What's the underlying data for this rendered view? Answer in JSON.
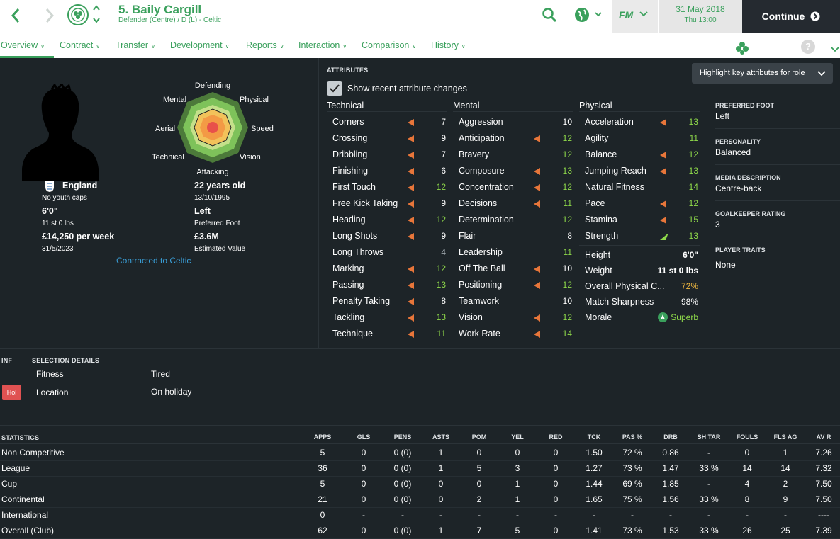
{
  "header": {
    "title": "5. Baily Cargill",
    "subtitle": "Defender (Centre) / D (L) - Celtic",
    "fm_label": "FM",
    "date": "31 May 2018",
    "time": "Thu 13:00",
    "continue_label": "Continue"
  },
  "tabs": [
    {
      "label": "Overview"
    },
    {
      "label": "Contract"
    },
    {
      "label": "Transfer"
    },
    {
      "label": "Development"
    },
    {
      "label": "Reports"
    },
    {
      "label": "Interaction"
    },
    {
      "label": "Comparison"
    },
    {
      "label": "History"
    }
  ],
  "profile": {
    "nation": "England",
    "caps": "No youth caps",
    "age": "22 years old",
    "dob": "13/10/1995",
    "height": "6'0\"",
    "weight": "11 st 0 lbs",
    "foot": "Left",
    "foot_label": "Preferred Foot",
    "wage": "£14,250 per week",
    "contract_end": "31/5/2023",
    "value": "£3.6M",
    "value_label": "Estimated Value",
    "contracted_to": "Contracted to Celtic"
  },
  "radar": {
    "labels": [
      "Defending",
      "Physical",
      "Speed",
      "Vision",
      "Attacking",
      "Technical",
      "Aerial",
      "Mental"
    ]
  },
  "attributes": {
    "header": "ATTRIBUTES",
    "show_changes_label": "Show recent attribute changes",
    "highlight_label": "Highlight key attributes for role",
    "technical_title": "Technical",
    "mental_title": "Mental",
    "physical_title": "Physical",
    "technical": [
      {
        "name": "Corners",
        "value": "7",
        "arrow": true
      },
      {
        "name": "Crossing",
        "value": "9",
        "arrow": true
      },
      {
        "name": "Dribbling",
        "value": "7",
        "arrow": true
      },
      {
        "name": "Finishing",
        "value": "6",
        "arrow": true
      },
      {
        "name": "First Touch",
        "value": "12",
        "arrow": true
      },
      {
        "name": "Free Kick Taking",
        "value": "9",
        "arrow": true
      },
      {
        "name": "Heading",
        "value": "12",
        "arrow": true
      },
      {
        "name": "Long Shots",
        "value": "9",
        "arrow": true
      },
      {
        "name": "Long Throws",
        "value": "4",
        "arrow": false
      },
      {
        "name": "Marking",
        "value": "12",
        "arrow": true
      },
      {
        "name": "Passing",
        "value": "13",
        "arrow": true
      },
      {
        "name": "Penalty Taking",
        "value": "8",
        "arrow": true
      },
      {
        "name": "Tackling",
        "value": "13",
        "arrow": true
      },
      {
        "name": "Technique",
        "value": "11",
        "arrow": true
      }
    ],
    "mental": [
      {
        "name": "Aggression",
        "value": "10",
        "arrow": false
      },
      {
        "name": "Anticipation",
        "value": "12",
        "arrow": true
      },
      {
        "name": "Bravery",
        "value": "12",
        "arrow": false
      },
      {
        "name": "Composure",
        "value": "13",
        "arrow": true
      },
      {
        "name": "Concentration",
        "value": "12",
        "arrow": true
      },
      {
        "name": "Decisions",
        "value": "11",
        "arrow": true
      },
      {
        "name": "Determination",
        "value": "12",
        "arrow": false
      },
      {
        "name": "Flair",
        "value": "8",
        "arrow": false
      },
      {
        "name": "Leadership",
        "value": "11",
        "arrow": false
      },
      {
        "name": "Off The Ball",
        "value": "10",
        "arrow": true
      },
      {
        "name": "Positioning",
        "value": "12",
        "arrow": true
      },
      {
        "name": "Teamwork",
        "value": "10",
        "arrow": false
      },
      {
        "name": "Vision",
        "value": "12",
        "arrow": true
      },
      {
        "name": "Work Rate",
        "value": "14",
        "arrow": true
      }
    ],
    "physical": [
      {
        "name": "Acceleration",
        "value": "13",
        "arrow": "down"
      },
      {
        "name": "Agility",
        "value": "11",
        "arrow": "none"
      },
      {
        "name": "Balance",
        "value": "12",
        "arrow": "down"
      },
      {
        "name": "Jumping Reach",
        "value": "13",
        "arrow": "down"
      },
      {
        "name": "Natural Fitness",
        "value": "14",
        "arrow": "none"
      },
      {
        "name": "Pace",
        "value": "12",
        "arrow": "down"
      },
      {
        "name": "Stamina",
        "value": "15",
        "arrow": "down"
      },
      {
        "name": "Strength",
        "value": "13",
        "arrow": "up"
      }
    ],
    "physical_info": [
      {
        "name": "Height",
        "value": "6'0\""
      },
      {
        "name": "Weight",
        "value": "11 st 0 lbs"
      },
      {
        "name": "Overall Physical C...",
        "value": "72%"
      },
      {
        "name": "Match Sharpness",
        "value": "98%"
      },
      {
        "name": "Morale",
        "value": "Superb"
      }
    ]
  },
  "side": {
    "preferred_foot_h": "PREFERRED FOOT",
    "preferred_foot": "Left",
    "personality_h": "PERSONALITY",
    "personality": "Balanced",
    "media_h": "MEDIA DESCRIPTION",
    "media": "Centre-back",
    "gk_h": "GOALKEEPER RATING",
    "gk": "3",
    "traits_h": "PLAYER TRAITS",
    "traits": "None"
  },
  "selection": {
    "inf_h": "INF",
    "header": "SELECTION DETAILS",
    "fitness_label": "Fitness",
    "fitness": "Tired",
    "location_label": "Location",
    "location": "On holiday",
    "badge": "Hol"
  },
  "statistics": {
    "header": "STATISTICS",
    "columns": [
      "APPS",
      "GLS",
      "PENS",
      "ASTS",
      "POM",
      "YEL",
      "RED",
      "TCK",
      "PAS %",
      "DRB",
      "SH TAR",
      "FOULS",
      "FLS AG",
      "AV R"
    ],
    "rows": [
      {
        "label": "Non Competitive",
        "cells": [
          "5",
          "0",
          "0 (0)",
          "1",
          "0",
          "0",
          "0",
          "1.50",
          "72 %",
          "0.86",
          "-",
          "0",
          "1",
          "7.26"
        ]
      },
      {
        "label": "League",
        "cells": [
          "36",
          "0",
          "0 (0)",
          "1",
          "5",
          "3",
          "0",
          "1.27",
          "73 %",
          "1.47",
          "33 %",
          "14",
          "14",
          "7.32"
        ]
      },
      {
        "label": "Cup",
        "cells": [
          "5",
          "0",
          "0 (0)",
          "0",
          "0",
          "1",
          "0",
          "1.44",
          "69 %",
          "1.85",
          "-",
          "4",
          "2",
          "7.50"
        ]
      },
      {
        "label": "Continental",
        "cells": [
          "21",
          "0",
          "0 (0)",
          "0",
          "2",
          "1",
          "0",
          "1.65",
          "75 %",
          "1.56",
          "33 %",
          "8",
          "9",
          "7.50"
        ]
      },
      {
        "label": "International",
        "cells": [
          "0",
          "-",
          "-",
          "-",
          "-",
          "-",
          "-",
          "-",
          "-",
          "-",
          "-",
          "-",
          "-",
          "----"
        ]
      },
      {
        "label": "Overall (Club)",
        "cells": [
          "62",
          "0",
          "0 (0)",
          "1",
          "7",
          "5",
          "0",
          "1.41",
          "73 %",
          "1.53",
          "33 %",
          "26",
          "25",
          "7.39"
        ]
      }
    ]
  },
  "colors": {
    "accent": "#3aa05c",
    "value_green": "#8ed84a",
    "arrow_orange": "#e8763a"
  }
}
